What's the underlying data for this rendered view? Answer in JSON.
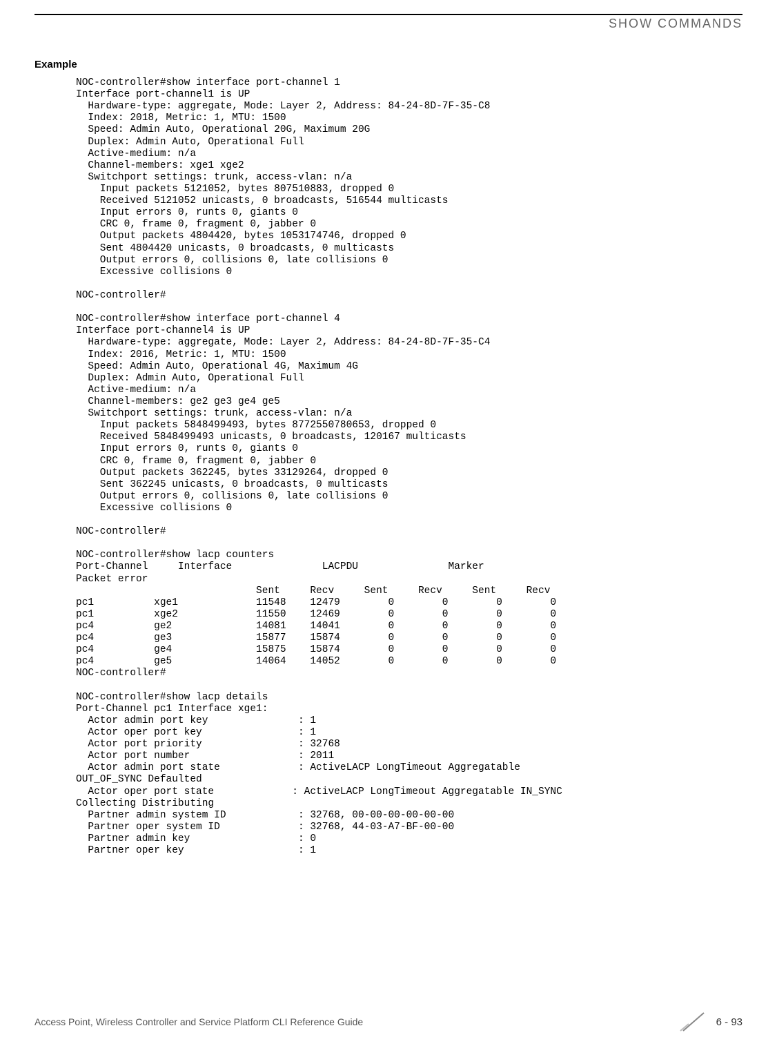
{
  "header": {
    "section_title": "SHOW COMMANDS"
  },
  "example_heading": "Example",
  "cli_output": {
    "block1": "NOC-controller#show interface port-channel 1\nInterface port-channel1 is UP\n  Hardware-type: aggregate, Mode: Layer 2, Address: 84-24-8D-7F-35-C8\n  Index: 2018, Metric: 1, MTU: 1500\n  Speed: Admin Auto, Operational 20G, Maximum 20G\n  Duplex: Admin Auto, Operational Full\n  Active-medium: n/a\n  Channel-members: xge1 xge2\n  Switchport settings: trunk, access-vlan: n/a\n    Input packets 5121052, bytes 807510883, dropped 0\n    Received 5121052 unicasts, 0 broadcasts, 516544 multicasts\n    Input errors 0, runts 0, giants 0\n    CRC 0, frame 0, fragment 0, jabber 0\n    Output packets 4804420, bytes 1053174746, dropped 0\n    Sent 4804420 unicasts, 0 broadcasts, 0 multicasts\n    Output errors 0, collisions 0, late collisions 0\n    Excessive collisions 0\n\nNOC-controller#\n\nNOC-controller#show interface port-channel 4\nInterface port-channel4 is UP\n  Hardware-type: aggregate, Mode: Layer 2, Address: 84-24-8D-7F-35-C4\n  Index: 2016, Metric: 1, MTU: 1500\n  Speed: Admin Auto, Operational 4G, Maximum 4G\n  Duplex: Admin Auto, Operational Full\n  Active-medium: n/a\n  Channel-members: ge2 ge3 ge4 ge5\n  Switchport settings: trunk, access-vlan: n/a\n    Input packets 5848499493, bytes 8772550780653, dropped 0\n    Received 5848499493 unicasts, 0 broadcasts, 120167 multicasts\n    Input errors 0, runts 0, giants 0\n    CRC 0, frame 0, fragment 0, jabber 0\n    Output packets 362245, bytes 33129264, dropped 0\n    Sent 362245 unicasts, 0 broadcasts, 0 multicasts\n    Output errors 0, collisions 0, late collisions 0\n    Excessive collisions 0\n\nNOC-controller#\n\nNOC-controller#show lacp counters\nPort-Channel     Interface               LACPDU               Marker       \nPacket error\n                              Sent     Recv     Sent     Recv     Sent     Recv\npc1          xge1             11548    12479        0        0        0        0\npc1          xge2             11550    12469        0        0        0        0\npc4          ge2              14081    14041        0        0        0        0\npc4          ge3              15877    15874        0        0        0        0\npc4          ge4              15875    15874        0        0        0        0\npc4          ge5              14064    14052        0        0        0        0\nNOC-controller#\n\nNOC-controller#show lacp details\nPort-Channel pc1 Interface xge1:\n  Actor admin port key               : 1\n  Actor oper port key                : 1\n  Actor port priority                : 32768\n  Actor port number                  : 2011\n  Actor admin port state             : ActiveLACP LongTimeout Aggregatable \nOUT_OF_SYNC Defaulted\n  Actor oper port state             : ActiveLACP LongTimeout Aggregatable IN_SYNC \nCollecting Distributing\n  Partner admin system ID            : 32768, 00-00-00-00-00-00\n  Partner oper system ID             : 32768, 44-03-A7-BF-00-00\n  Partner admin key                  : 0\n  Partner oper key                   : 1"
  },
  "footer": {
    "left_text": "Access Point, Wireless Controller and Service Platform CLI Reference Guide",
    "page_number": "6 - 93"
  }
}
